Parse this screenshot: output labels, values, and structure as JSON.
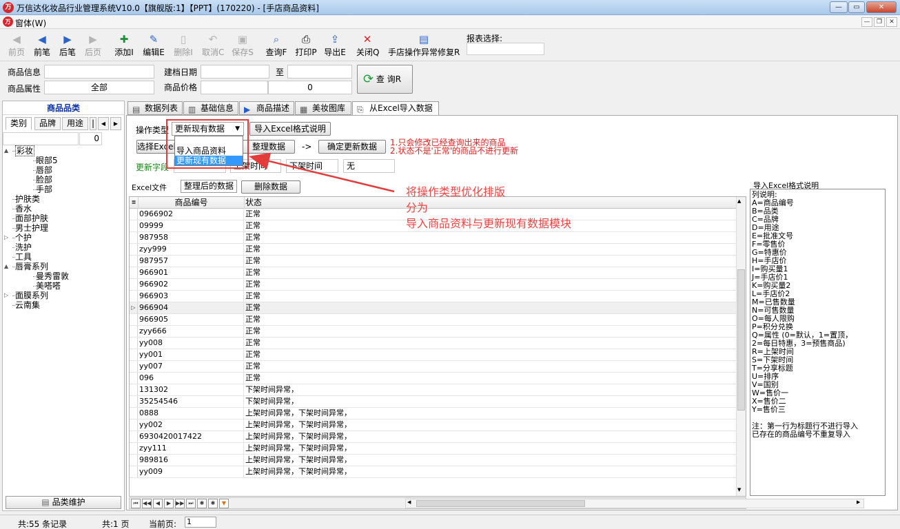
{
  "window": {
    "title": "万信达化妆品行业管理系统V10.0【旗舰版:1】【PPT】(170220) - [手店商品资料]",
    "app_icon": "logo-icon",
    "controls": [
      "—",
      "▭",
      "✕"
    ]
  },
  "menubar": {
    "menu": "窗体(W)",
    "mdi_controls": [
      "—",
      "❐",
      "✕"
    ]
  },
  "toolbar": {
    "buttons": [
      {
        "label": "前页",
        "icon": "first-page-icon",
        "glyph": "◀",
        "enabled": false
      },
      {
        "label": "前笔",
        "icon": "prev-record-icon",
        "glyph": "◀",
        "enabled": true
      },
      {
        "label": "后笔",
        "icon": "next-record-icon",
        "glyph": "▶",
        "enabled": true
      },
      {
        "label": "后页",
        "icon": "last-page-icon",
        "glyph": "▶",
        "enabled": false
      },
      {
        "label": "添加I",
        "icon": "add-icon",
        "glyph": "✚",
        "enabled": true
      },
      {
        "label": "编辑E",
        "icon": "edit-icon",
        "glyph": "✎",
        "enabled": true
      },
      {
        "label": "删除I",
        "icon": "delete-icon",
        "glyph": "▯",
        "enabled": false
      },
      {
        "label": "取消C",
        "icon": "undo-icon",
        "glyph": "↶",
        "enabled": false
      },
      {
        "label": "保存S",
        "icon": "save-icon",
        "glyph": "▣",
        "enabled": false
      },
      {
        "label": "查询F",
        "icon": "search-icon",
        "glyph": "⌕",
        "enabled": true
      },
      {
        "label": "打印P",
        "icon": "print-icon",
        "glyph": "⎙",
        "enabled": true
      },
      {
        "label": "导出E",
        "icon": "export-icon",
        "glyph": "⇪",
        "enabled": true
      },
      {
        "label": "关闭Q",
        "icon": "close-icon",
        "glyph": "✕",
        "enabled": true
      },
      {
        "label": "手店操作异常修复R",
        "icon": "repair-icon",
        "glyph": "▤",
        "enabled": true
      }
    ],
    "report_label": "报表选择:",
    "report_value": ""
  },
  "filter": {
    "product_info_label": "商品信息",
    "product_info_value": "",
    "product_attr_label": "商品属性",
    "product_attr_value": "全部",
    "date_label": "建档日期",
    "date_from": "",
    "date_to_label": "至",
    "date_to": "",
    "price_label": "商品价格",
    "price_from": "",
    "price_to": "0",
    "query_button": "查 询R"
  },
  "left_panel": {
    "header": "商品品类",
    "tabs": [
      "类别",
      "品牌",
      "用途",
      "|"
    ],
    "tab_scroll": [
      "◀",
      "▶"
    ],
    "filter_value": "",
    "count": "0",
    "tree": [
      {
        "label": "彩妆",
        "level": 0,
        "expander": "▲",
        "selected": true
      },
      {
        "label": "眼部5",
        "level": 1
      },
      {
        "label": "唇部",
        "level": 1
      },
      {
        "label": "脸部",
        "level": 1
      },
      {
        "label": "手部",
        "level": 1
      },
      {
        "label": "护肤类",
        "level": 0
      },
      {
        "label": "香水",
        "level": 0
      },
      {
        "label": "面部护肤",
        "level": 0
      },
      {
        "label": "男士护理",
        "level": 0
      },
      {
        "label": "个护",
        "level": 0,
        "expander": "▷"
      },
      {
        "label": "洗护",
        "level": 0
      },
      {
        "label": "工具",
        "level": 0
      },
      {
        "label": "唇膏系列",
        "level": 0,
        "expander": "▲"
      },
      {
        "label": "曼秀雷敦",
        "level": 1
      },
      {
        "label": "美嗒嗒",
        "level": 1
      },
      {
        "label": "面膜系列",
        "level": 0,
        "expander": "▷"
      },
      {
        "label": "云南集",
        "level": 0
      }
    ],
    "maint_button": "品类维护"
  },
  "tabs": [
    {
      "label": "数据列表",
      "icon": "list-icon"
    },
    {
      "label": "基础信息",
      "icon": "info-icon"
    },
    {
      "label": "商品描述",
      "icon": "play-icon"
    },
    {
      "label": "美妆图库",
      "icon": "gallery-icon"
    },
    {
      "label": "从Excel导入数据",
      "icon": "import-icon"
    }
  ],
  "import": {
    "op_label": "操作类型",
    "op_value": "更新现有数据",
    "op_options": [
      "导入商品资料",
      "更新现有数据"
    ],
    "excel_help_button": "导入Excel格式说明",
    "select_excel_button": "选择Excel",
    "organize_button": "整理数据",
    "arrow": "->",
    "confirm_button": "确定更新数据",
    "notes": [
      "1.只会修改已经查询出来的商品",
      "2.状态不是'正常'的商品不进行更新"
    ],
    "update_fields_label": "更新字段",
    "field_boxes": [
      "",
      "上架时间",
      "下架时间",
      "无"
    ],
    "subtabs": [
      "Excel文件",
      "整理后的数据"
    ],
    "delete_button": "删除数据"
  },
  "grid": {
    "columns": [
      "商品编号",
      "状态"
    ],
    "selected_row": 8,
    "rows": [
      [
        "0966902",
        "正常"
      ],
      [
        "09999",
        "正常"
      ],
      [
        "987958",
        "正常"
      ],
      [
        "zyy999",
        "正常"
      ],
      [
        "987957",
        "正常"
      ],
      [
        "966901",
        "正常"
      ],
      [
        "966902",
        "正常"
      ],
      [
        "966903",
        "正常"
      ],
      [
        "966904",
        "正常"
      ],
      [
        "966905",
        "正常"
      ],
      [
        "zyy666",
        "正常"
      ],
      [
        "yy008",
        "正常"
      ],
      [
        "yy001",
        "正常"
      ],
      [
        "yy007",
        "正常"
      ],
      [
        "096",
        "正常"
      ],
      [
        "131302",
        "下架时间异常，"
      ],
      [
        "35254546",
        "下架时间异常，"
      ],
      [
        "0888",
        "上架时间异常，下架时间异常，"
      ],
      [
        "yy002",
        "上架时间异常，下架时间异常，"
      ],
      [
        "6930420017422",
        "上架时间异常，下架时间异常，"
      ],
      [
        "zyy111",
        "上架时间异常，下架时间异常，"
      ],
      [
        "989816",
        "上架时间异常，下架时间异常，"
      ],
      [
        "yy009",
        "上架时间异常，下架时间异常，"
      ]
    ],
    "nav_buttons": [
      "⏮",
      "◀◀",
      "◀",
      "▶",
      "▶▶",
      "⏭",
      "✱",
      "✱",
      "▼"
    ]
  },
  "help": {
    "title": "导入Excel格式说明",
    "lines": [
      "列说明:",
      "A=商品编号",
      "B=品类",
      "C=品牌",
      "D=用途",
      "E=批准文号",
      "F=零售价",
      "G=特惠价",
      "H=手店价",
      "I=购买量1",
      "J=手店价1",
      "K=购买量2",
      "L=手店价2",
      "M=已售数量",
      "N=可售数量",
      "O=每人限购",
      "P=积分兑换",
      "Q=属性 (0=默认，1=置顶，",
      "   2=每日特惠，3=预售商品)",
      "R=上架时间",
      "S=下架时间",
      "T=分享标题",
      "U=排序",
      "V=国别",
      "W=售价一",
      "X=售价二",
      "Y=售价三",
      "",
      "注：第一行为标题行不进行导入",
      "    已存在的商品编号不重复导入"
    ]
  },
  "annotation": {
    "lines": [
      "将操作类型优化排版",
      "分为",
      "导入商品资料与更新现有数据模块"
    ],
    "color": "#ef4444"
  },
  "status": {
    "records": "共:55 条记录",
    "pages": "共:1 页",
    "current_label": "当前页:",
    "current_value": "1"
  }
}
